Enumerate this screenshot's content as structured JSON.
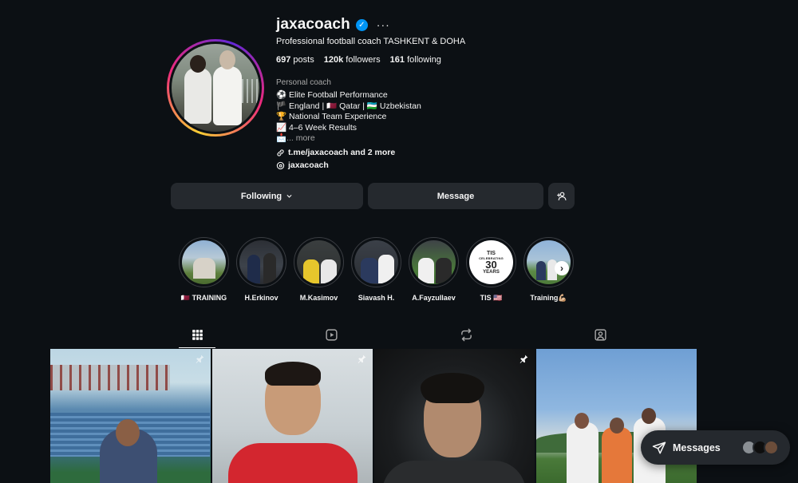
{
  "profile": {
    "username": "jaxacoach",
    "subtitle": "Professional football coach TASHKENT & DOHA",
    "stats": {
      "posts_count": "697",
      "posts_label": "posts",
      "followers_count": "120k",
      "followers_label": "followers",
      "following_count": "161",
      "following_label": "following"
    },
    "category": "Personal coach",
    "bio": [
      "⚽ Elite Football Performance",
      "🏴 England | 🇶🇦 Qatar | 🇺🇿 Uzbekistan",
      "🏆 National Team Experience",
      "📈 4–6 Week Results",
      "📩"
    ],
    "bio_more": "... more",
    "link_text": "t.me/jaxacoach and 2 more",
    "threads_handle": "jaxacoach"
  },
  "actions": {
    "following_label": "Following",
    "message_label": "Message"
  },
  "highlights": [
    {
      "label": "🇶🇦 TRAINING"
    },
    {
      "label": "H.Erkinov"
    },
    {
      "label": "M.Kasimov"
    },
    {
      "label": "Siavash H."
    },
    {
      "label": "A.Fayzullaev"
    },
    {
      "label": "TIS 🇺🇸"
    },
    {
      "label": "Training💪🏼"
    }
  ],
  "tis_badge": {
    "line1": "TIS",
    "line2": "CELEBRATING",
    "line3": "30",
    "line4": "YEARS"
  },
  "tabs": [
    {
      "icon": "grid-icon",
      "active": true
    },
    {
      "icon": "reels-icon",
      "active": false
    },
    {
      "icon": "reposts-icon",
      "active": false
    },
    {
      "icon": "tagged-icon",
      "active": false
    }
  ],
  "messages_pill": {
    "label": "Messages"
  },
  "colors": {
    "background": "#0c1014",
    "button": "#25292e",
    "verified": "#0095f6",
    "muted": "#a8a8a8"
  }
}
